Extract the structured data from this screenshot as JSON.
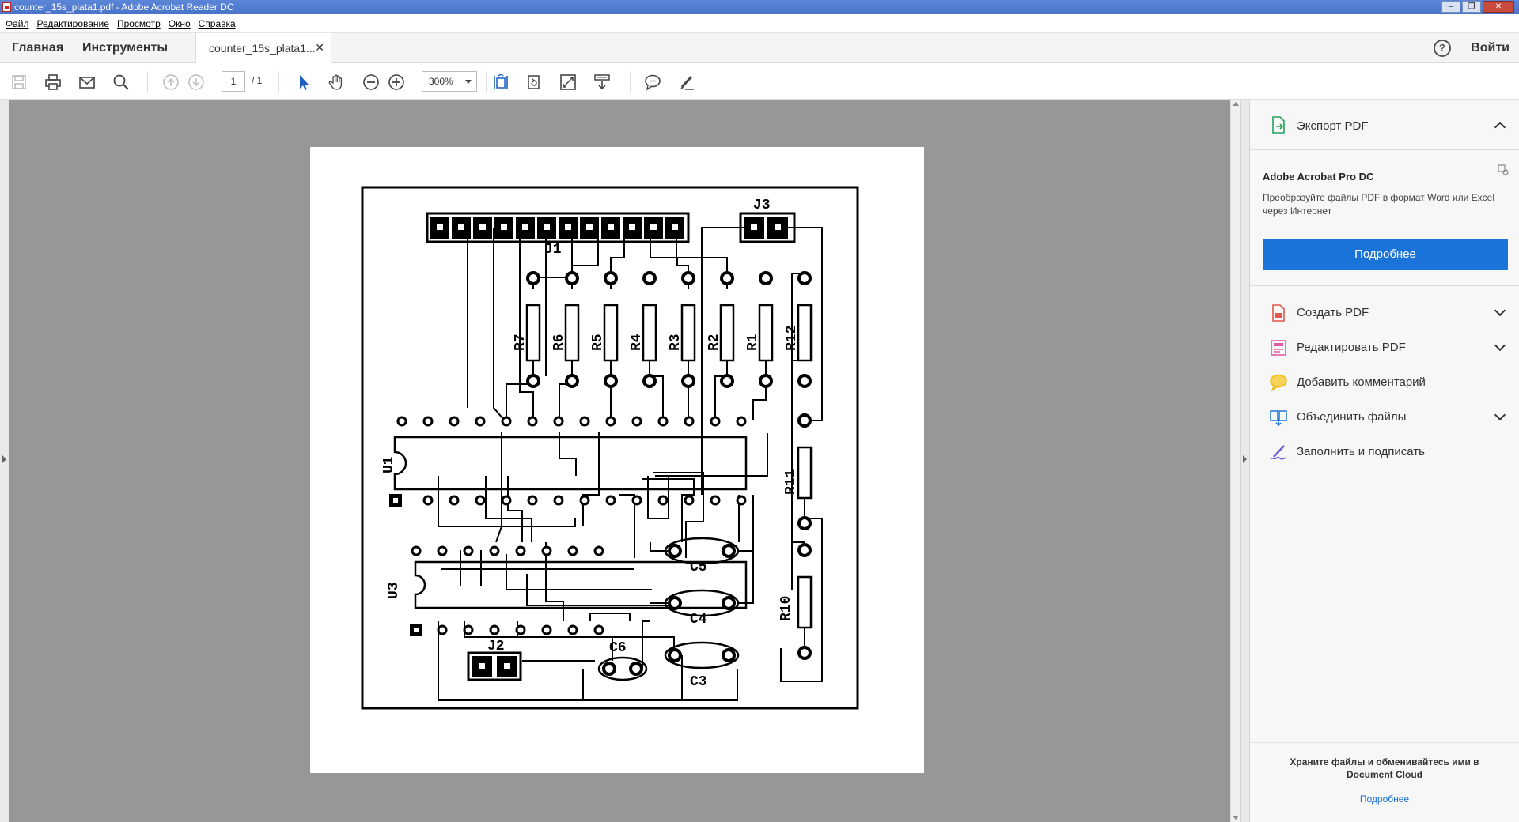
{
  "window": {
    "title": "counter_15s_plata1.pdf - Adobe Acrobat Reader DC"
  },
  "menu": [
    "Файл",
    "Редактирование",
    "Просмотр",
    "Окно",
    "Справка"
  ],
  "tabs": {
    "home": "Главная",
    "tools": "Инструменты",
    "document": "counter_15s_plata1...",
    "help": "?",
    "signin": "Войти"
  },
  "toolbar": {
    "page_current": "1",
    "page_total": "/ 1",
    "zoom": "300%"
  },
  "pcb": {
    "labels": {
      "j1": "J1",
      "j2": "J2",
      "j3": "J3",
      "u1": "U1",
      "u3": "U3",
      "r1": "R1",
      "r2": "R2",
      "r3": "R3",
      "r4": "R4",
      "r5": "R5",
      "r6": "R6",
      "r7": "R7",
      "r10": "R10",
      "r11": "R11",
      "r12": "R12",
      "c3": "C3",
      "c4": "C4",
      "c5": "C5",
      "c6": "C6"
    }
  },
  "right_panel": {
    "export_label": "Экспорт PDF",
    "promo_title": "Adobe Acrobat Pro DC",
    "promo_desc": "Преобразуйте файлы PDF в формат Word или Excel через Интернет",
    "promo_button": "Подробнее",
    "items": [
      {
        "label": "Создать PDF",
        "color": "#e2574c"
      },
      {
        "label": "Редактировать PDF",
        "color": "#e05aa8"
      },
      {
        "label": "Добавить комментарий",
        "color": "#f2b705"
      },
      {
        "label": "Объединить файлы",
        "color": "#1a73d9"
      },
      {
        "label": "Заполнить и подписать",
        "color": "#6b5cd6"
      }
    ],
    "footer_text": "Храните файлы и обменивайтесь ими в Document Cloud",
    "footer_link": "Подробнее"
  }
}
